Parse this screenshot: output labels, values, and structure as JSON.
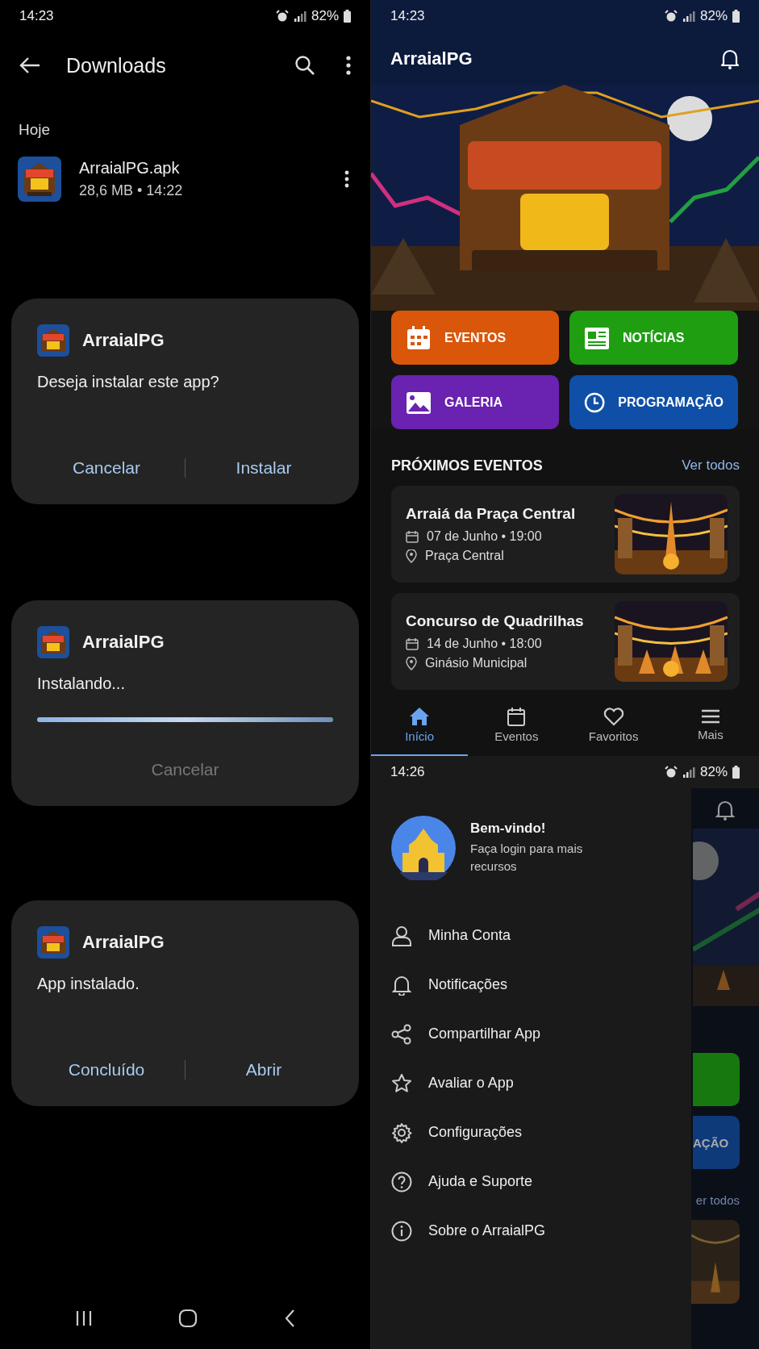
{
  "downloads_screen": {
    "status_bar": {
      "time": "14:23",
      "battery": "82%"
    },
    "title": "Downloads",
    "section": "Hoje",
    "file": {
      "name": "ArraialPG.apk",
      "meta": "28,6 MB • 14:22"
    },
    "dialogs": [
      {
        "kind": "prompt",
        "app": "ArraialPG",
        "message": "Deseja instalar este app?",
        "buttons": [
          {
            "label": "Cancelar",
            "disabled": false
          },
          {
            "label": "Instalar",
            "disabled": false
          }
        ]
      },
      {
        "kind": "progress",
        "app": "ArraialPG",
        "message": "Instalando...",
        "level": 1,
        "buttons": [
          {
            "label": "Cancelar",
            "disabled": true
          }
        ]
      },
      {
        "kind": "prompt",
        "app": "ArraialPG",
        "message": "App instalado.",
        "buttons": [
          {
            "label": "Concluído",
            "disabled": false
          },
          {
            "label": "Abrir",
            "disabled": false
          }
        ]
      }
    ]
  },
  "app_screen": {
    "status_bar": {
      "time": "14:23",
      "battery": "82%"
    },
    "title": "ArraialPG",
    "shortcuts": [
      {
        "label": "EVENTOS",
        "color": "#d9560a"
      },
      {
        "label": "NOTÍCIAS",
        "color": "#1f9e12"
      },
      {
        "label": "GALERIA",
        "color": "#6a22b0"
      },
      {
        "label": "PROGRAMAÇÃO",
        "color": "#0f4fa8"
      }
    ],
    "section_title": "PRÓXIMOS EVENTOS",
    "see_all": "Ver todos",
    "events": [
      {
        "title": "Arraiá da Praça Central",
        "date": "07 de Junho • 19:00",
        "place": "Praça Central"
      },
      {
        "title": "Concurso de Quadrilhas",
        "date": "14 de Junho • 18:00",
        "place": "Ginásio Municipal"
      }
    ],
    "bottom_nav": [
      {
        "label": "Início",
        "selected": true
      },
      {
        "label": "Eventos",
        "selected": false
      },
      {
        "label": "Favoritos",
        "selected": false
      },
      {
        "label": "Mais",
        "selected": false
      }
    ]
  },
  "drawer_screen": {
    "status_bar": {
      "time": "14:26",
      "battery": "82%"
    },
    "profile": {
      "greeting": "Bem-vindo!",
      "subtitle": "Faça login para mais recursos"
    },
    "menu": [
      {
        "label": "Minha Conta"
      },
      {
        "label": "Notificações"
      },
      {
        "label": "Compartilhar App"
      },
      {
        "label": "Avaliar o App"
      },
      {
        "label": "Configurações"
      },
      {
        "label": "Ajuda e Suporte"
      },
      {
        "label": "Sobre o ArraialPG"
      }
    ],
    "background": {
      "button_text": "AÇÃO",
      "link_text": "er todos"
    }
  }
}
